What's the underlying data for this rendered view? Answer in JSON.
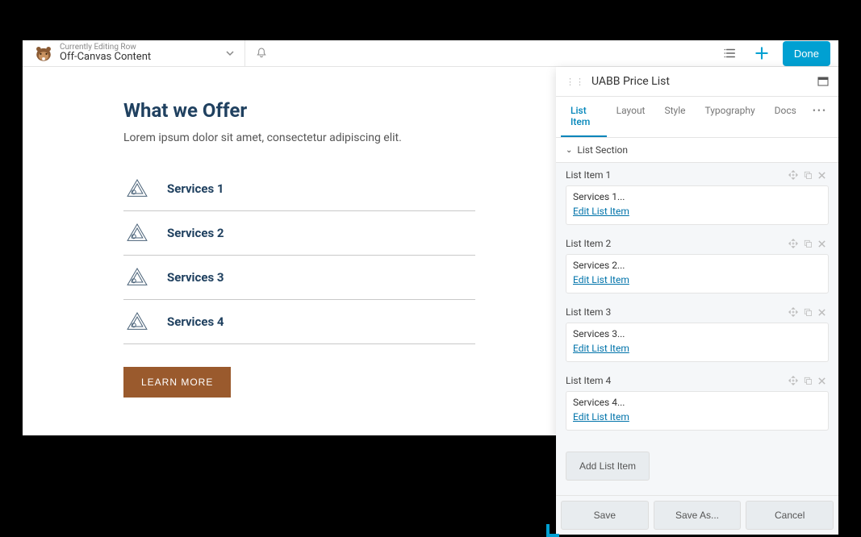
{
  "topbar": {
    "editing_label": "Currently Editing Row",
    "title": "Off-Canvas Content",
    "done_label": "Done"
  },
  "offer": {
    "heading": "What we Offer",
    "subtitle": "Lorem ipsum dolor sit amet, consectetur adipiscing elit.",
    "services": [
      {
        "label": "Services 1"
      },
      {
        "label": "Services 2"
      },
      {
        "label": "Services 3"
      },
      {
        "label": "Services 4"
      }
    ],
    "cta_label": "LEARN MORE"
  },
  "panel": {
    "title": "UABB Price List",
    "tabs": [
      {
        "label": "List Item",
        "active": true
      },
      {
        "label": "Layout",
        "active": false
      },
      {
        "label": "Style",
        "active": false
      },
      {
        "label": "Typography",
        "active": false
      },
      {
        "label": "Docs",
        "active": false
      }
    ],
    "section_title": "List Section",
    "items": [
      {
        "header": "List Item 1",
        "desc": "Services 1...",
        "edit": "Edit List Item"
      },
      {
        "header": "List Item 2",
        "desc": "Services 2...",
        "edit": "Edit List Item"
      },
      {
        "header": "List Item 3",
        "desc": "Services 3...",
        "edit": "Edit List Item"
      },
      {
        "header": "List Item 4",
        "desc": "Services 4...",
        "edit": "Edit List Item"
      }
    ],
    "add_item_label": "Add List Item",
    "footer": {
      "save": "Save",
      "save_as": "Save As...",
      "cancel": "Cancel"
    }
  }
}
